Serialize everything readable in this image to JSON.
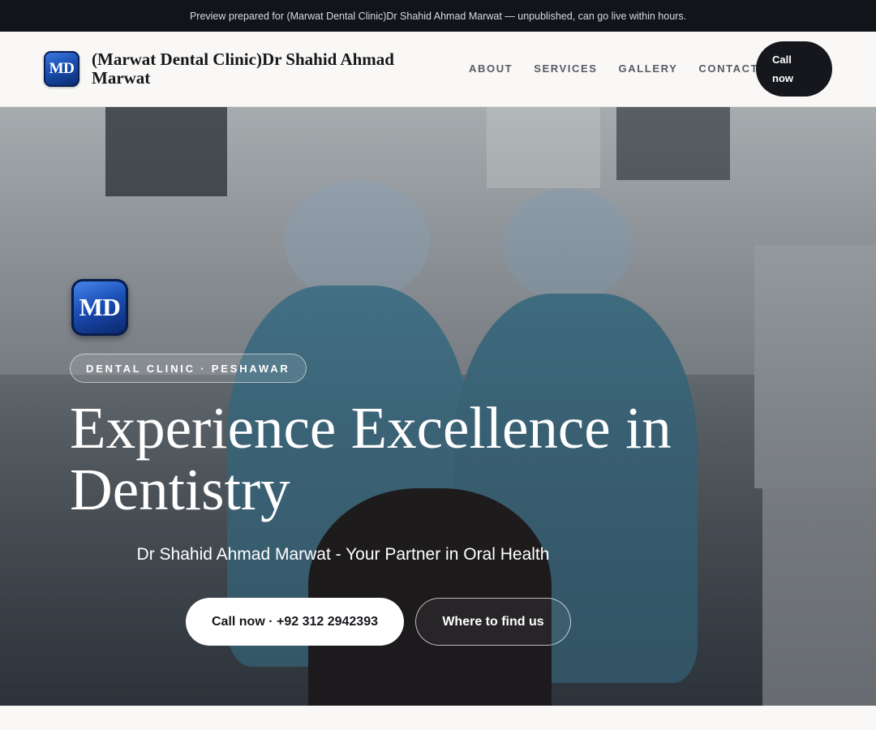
{
  "preview_bar": {
    "text": "Preview prepared for (Marwat Dental Clinic)Dr Shahid Ahmad Marwat — unpublished, can go live within hours."
  },
  "header": {
    "logo_text": "MD",
    "brand_name": "(Marwat Dental Clinic)Dr Shahid Ahmad Marwat",
    "nav": [
      "ABOUT",
      "SERVICES",
      "GALLERY",
      "CONTACT"
    ],
    "call_button": "Call now"
  },
  "hero": {
    "logo_text": "MD",
    "pill": "DENTAL CLINIC · PESHAWAR",
    "title": "Experience Excellence in Dentistry",
    "subtitle": "Dr Shahid Ahmad Marwat - Your Partner in Oral Health",
    "primary_button": "Call now · +92 312 2942393",
    "secondary_button": "Where to find us",
    "image_alt_icon": "dental-procedure-photo"
  },
  "colors": {
    "dark": "#111418",
    "accent_blue": "#1b4fb6",
    "white": "#ffffff"
  }
}
